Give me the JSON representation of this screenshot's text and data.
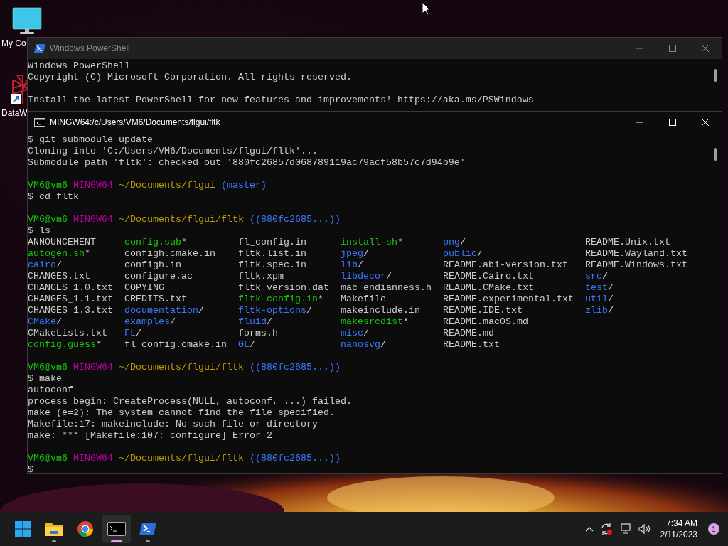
{
  "desktop_icons": [
    {
      "label": "My Co",
      "kind": "computer"
    },
    {
      "label": "DataW",
      "kind": "shortcut"
    }
  ],
  "windows": [
    {
      "title": "Windows PowerShell",
      "kind": "powershell",
      "active": false,
      "lines": [
        {
          "kind": "text",
          "text": "Windows PowerShell"
        },
        {
          "kind": "text",
          "text": "Copyright (C) Microsoft Corporation. All rights reserved."
        },
        {
          "kind": "blank"
        },
        {
          "kind": "text",
          "text": "Install the latest PowerShell for new features and improvements! https://aka.ms/PSWindows"
        }
      ]
    },
    {
      "title": "MINGW64:/c/Users/VM6/Documents/flgui/fltk",
      "kind": "console",
      "active": true,
      "lines": [
        {
          "kind": "text",
          "text": "$ git submodule update"
        },
        {
          "kind": "text",
          "text": "Cloning into 'C:/Users/VM6/Documents/flgui/fltk'..."
        },
        {
          "kind": "text",
          "text": "Submodule path 'fltk': checked out '880fc26857d068789119ac79acf58b57c7d94b9e'"
        },
        {
          "kind": "blank"
        },
        {
          "kind": "prompt",
          "user": "VM6@vm6",
          "shell": "MINGW64",
          "path": "~/Documents/flgui",
          "branch": "(master)"
        },
        {
          "kind": "text",
          "text": "$ cd fltk"
        },
        {
          "kind": "blank"
        },
        {
          "kind": "prompt",
          "user": "VM6@vm6",
          "shell": "MINGW64",
          "path": "~/Documents/flgui/fltk",
          "branch": "((880fc2685...))"
        },
        {
          "kind": "text",
          "text": "$ ls"
        },
        {
          "kind": "listing",
          "columns": [
            [
              {
                "name": "ANNOUNCEMENT",
                "kind": "file"
              },
              {
                "name": "autogen.sh",
                "suffix": "*",
                "kind": "exec"
              },
              {
                "name": "cairo",
                "suffix": "/",
                "kind": "dir"
              },
              {
                "name": "CHANGES.txt",
                "kind": "file"
              },
              {
                "name": "CHANGES_1.0.txt",
                "kind": "file"
              },
              {
                "name": "CHANGES_1.1.txt",
                "kind": "file"
              },
              {
                "name": "CHANGES_1.3.txt",
                "kind": "file"
              },
              {
                "name": "CMake",
                "suffix": "/",
                "kind": "dir"
              },
              {
                "name": "CMakeLists.txt",
                "kind": "file"
              },
              {
                "name": "config.guess",
                "suffix": "*",
                "kind": "exec"
              }
            ],
            [
              {
                "name": "config.sub",
                "suffix": "*",
                "kind": "exec"
              },
              {
                "name": "configh.cmake.in",
                "kind": "file"
              },
              {
                "name": "configh.in",
                "kind": "file"
              },
              {
                "name": "configure.ac",
                "kind": "file"
              },
              {
                "name": "COPYING",
                "kind": "file"
              },
              {
                "name": "CREDITS.txt",
                "kind": "file"
              },
              {
                "name": "documentation",
                "suffix": "/",
                "kind": "dir"
              },
              {
                "name": "examples",
                "suffix": "/",
                "kind": "dir"
              },
              {
                "name": "FL",
                "suffix": "/",
                "kind": "dir"
              },
              {
                "name": "fl_config.cmake.in",
                "kind": "file"
              }
            ],
            [
              {
                "name": "fl_config.in",
                "kind": "file"
              },
              {
                "name": "fltk.list.in",
                "kind": "file"
              },
              {
                "name": "fltk.spec.in",
                "kind": "file"
              },
              {
                "name": "fltk.xpm",
                "kind": "file"
              },
              {
                "name": "fltk_version.dat",
                "kind": "file"
              },
              {
                "name": "fltk-config.in",
                "suffix": "*",
                "kind": "exec"
              },
              {
                "name": "fltk-options",
                "suffix": "/",
                "kind": "dir"
              },
              {
                "name": "fluid",
                "suffix": "/",
                "kind": "dir"
              },
              {
                "name": "forms.h",
                "kind": "file"
              },
              {
                "name": "GL",
                "suffix": "/",
                "kind": "dir"
              }
            ],
            [
              {
                "name": "install-sh",
                "suffix": "*",
                "kind": "exec"
              },
              {
                "name": "jpeg",
                "suffix": "/",
                "kind": "dir"
              },
              {
                "name": "lib",
                "suffix": "/",
                "kind": "dir"
              },
              {
                "name": "libdecor",
                "suffix": "/",
                "kind": "dir"
              },
              {
                "name": "mac_endianness.h",
                "kind": "file"
              },
              {
                "name": "Makefile",
                "kind": "file"
              },
              {
                "name": "makeinclude.in",
                "kind": "file"
              },
              {
                "name": "makesrcdist",
                "suffix": "*",
                "kind": "exec"
              },
              {
                "name": "misc",
                "suffix": "/",
                "kind": "dir"
              },
              {
                "name": "nanosvg",
                "suffix": "/",
                "kind": "dir"
              }
            ],
            [
              {
                "name": "png",
                "suffix": "/",
                "kind": "dir"
              },
              {
                "name": "public",
                "suffix": "/",
                "kind": "dir"
              },
              {
                "name": "README.abi-version.txt",
                "kind": "file"
              },
              {
                "name": "README.Cairo.txt",
                "kind": "file"
              },
              {
                "name": "README.CMake.txt",
                "kind": "file"
              },
              {
                "name": "README.experimental.txt",
                "kind": "file"
              },
              {
                "name": "README.IDE.txt",
                "kind": "file"
              },
              {
                "name": "README.macOS.md",
                "kind": "file"
              },
              {
                "name": "README.md",
                "kind": "file"
              },
              {
                "name": "README.txt",
                "kind": "file"
              }
            ],
            [
              {
                "name": "README.Unix.txt",
                "kind": "file"
              },
              {
                "name": "README.Wayland.txt",
                "kind": "file"
              },
              {
                "name": "README.Windows.txt",
                "kind": "file"
              },
              {
                "name": "src",
                "suffix": "/",
                "kind": "dir"
              },
              {
                "name": "test",
                "suffix": "/",
                "kind": "dir"
              },
              {
                "name": "util",
                "suffix": "/",
                "kind": "dir"
              },
              {
                "name": "zlib",
                "suffix": "/",
                "kind": "dir"
              }
            ]
          ]
        },
        {
          "kind": "blank"
        },
        {
          "kind": "prompt",
          "user": "VM6@vm6",
          "shell": "MINGW64",
          "path": "~/Documents/flgui/fltk",
          "branch": "((880fc2685...))"
        },
        {
          "kind": "text",
          "text": "$ make"
        },
        {
          "kind": "text",
          "text": "autoconf"
        },
        {
          "kind": "text",
          "text": "process_begin: CreateProcess(NULL, autoconf, ...) failed."
        },
        {
          "kind": "text",
          "text": "make (e=2): The system cannot find the file specified."
        },
        {
          "kind": "text",
          "text": "Makefile:17: makeinclude: No such file or directory"
        },
        {
          "kind": "text",
          "text": "make: *** [Makefile:107: configure] Error 2"
        },
        {
          "kind": "blank"
        },
        {
          "kind": "prompt",
          "user": "VM6@vm6",
          "shell": "MINGW64",
          "path": "~/Documents/flgui/fltk",
          "branch": "((880fc2685...))"
        },
        {
          "kind": "input",
          "text": "$"
        }
      ]
    }
  ],
  "taskbar": {
    "apps": [
      {
        "kind": "start",
        "selected": false,
        "running": false
      },
      {
        "kind": "explorer",
        "selected": false,
        "running": true
      },
      {
        "kind": "browser",
        "selected": false,
        "running": false
      },
      {
        "kind": "console",
        "selected": true,
        "running": true
      },
      {
        "kind": "powershell",
        "selected": false,
        "running": true
      }
    ],
    "time": "7:34 AM",
    "date": "2/11/2023",
    "notification_count": "1"
  }
}
